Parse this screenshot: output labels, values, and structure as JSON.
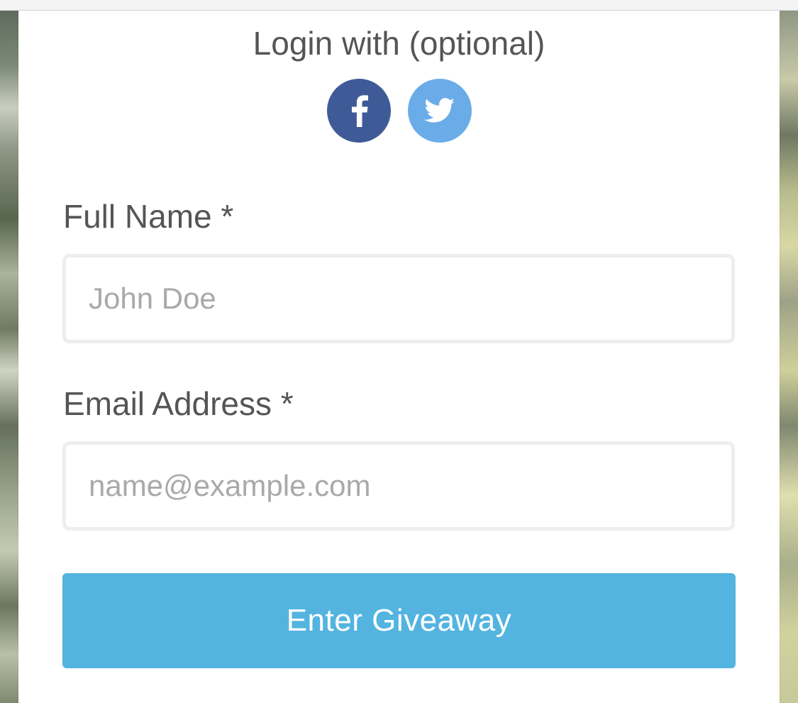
{
  "login": {
    "title": "Login with (optional)",
    "providers": [
      {
        "name": "facebook",
        "icon": "facebook-icon",
        "color": "#3f5b97"
      },
      {
        "name": "twitter",
        "icon": "twitter-icon",
        "color": "#6aace8"
      }
    ]
  },
  "form": {
    "full_name": {
      "label": "Full Name *",
      "value": "",
      "placeholder": "John Doe"
    },
    "email": {
      "label": "Email Address *",
      "value": "",
      "placeholder": "name@example.com"
    },
    "submit_label": "Enter Giveaway"
  },
  "colors": {
    "accent": "#53b4e0",
    "text": "#555555",
    "placeholder": "#a9a9a9",
    "input_border": "#eeeeee"
  }
}
